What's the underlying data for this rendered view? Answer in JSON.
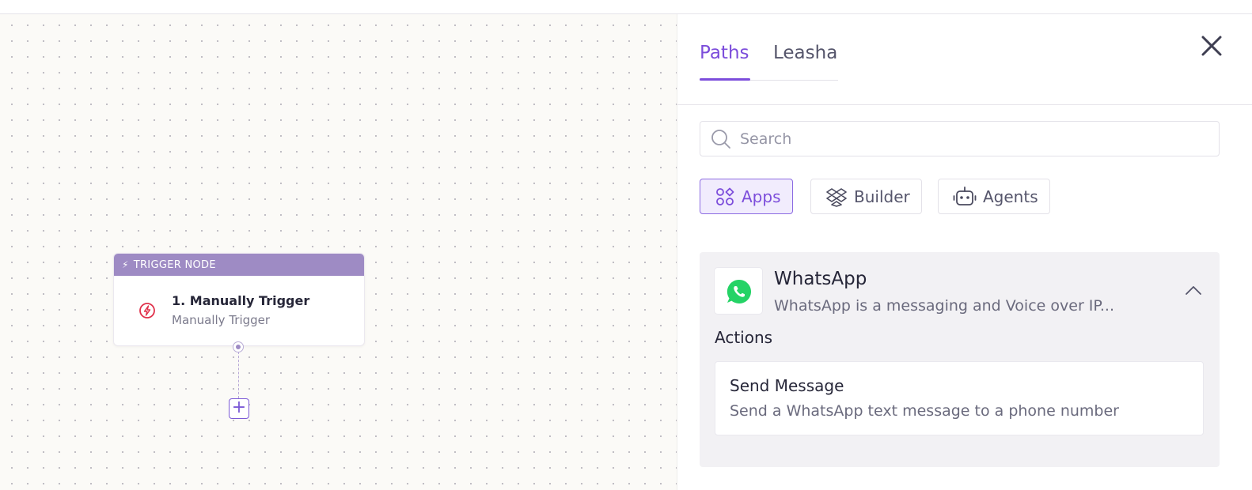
{
  "canvas": {
    "node": {
      "header": "TRIGGER NODE",
      "title": "1. Manually Trigger",
      "subtitle": "Manually Trigger"
    }
  },
  "panel": {
    "tabs": [
      {
        "label": "Paths",
        "active": true
      },
      {
        "label": "Leasha",
        "active": false
      }
    ],
    "search": {
      "placeholder": "Search",
      "value": ""
    },
    "filters": [
      {
        "label": "Apps",
        "icon": "apps-icon",
        "active": true
      },
      {
        "label": "Builder",
        "icon": "builder-icon",
        "active": false
      },
      {
        "label": "Agents",
        "icon": "agent-robot-icon",
        "active": false
      }
    ],
    "app": {
      "name": "WhatsApp",
      "description": "WhatsApp is a messaging and Voice over IP...",
      "actions_heading": "Actions",
      "actions": [
        {
          "title": "Send Message",
          "description": "Send a WhatsApp text message to a phone number"
        }
      ]
    }
  },
  "colors": {
    "accent": "#7c4ddb",
    "node_header": "#9e8bc4",
    "whatsapp": "#25d366",
    "trigger_icon": "#e0314b"
  }
}
